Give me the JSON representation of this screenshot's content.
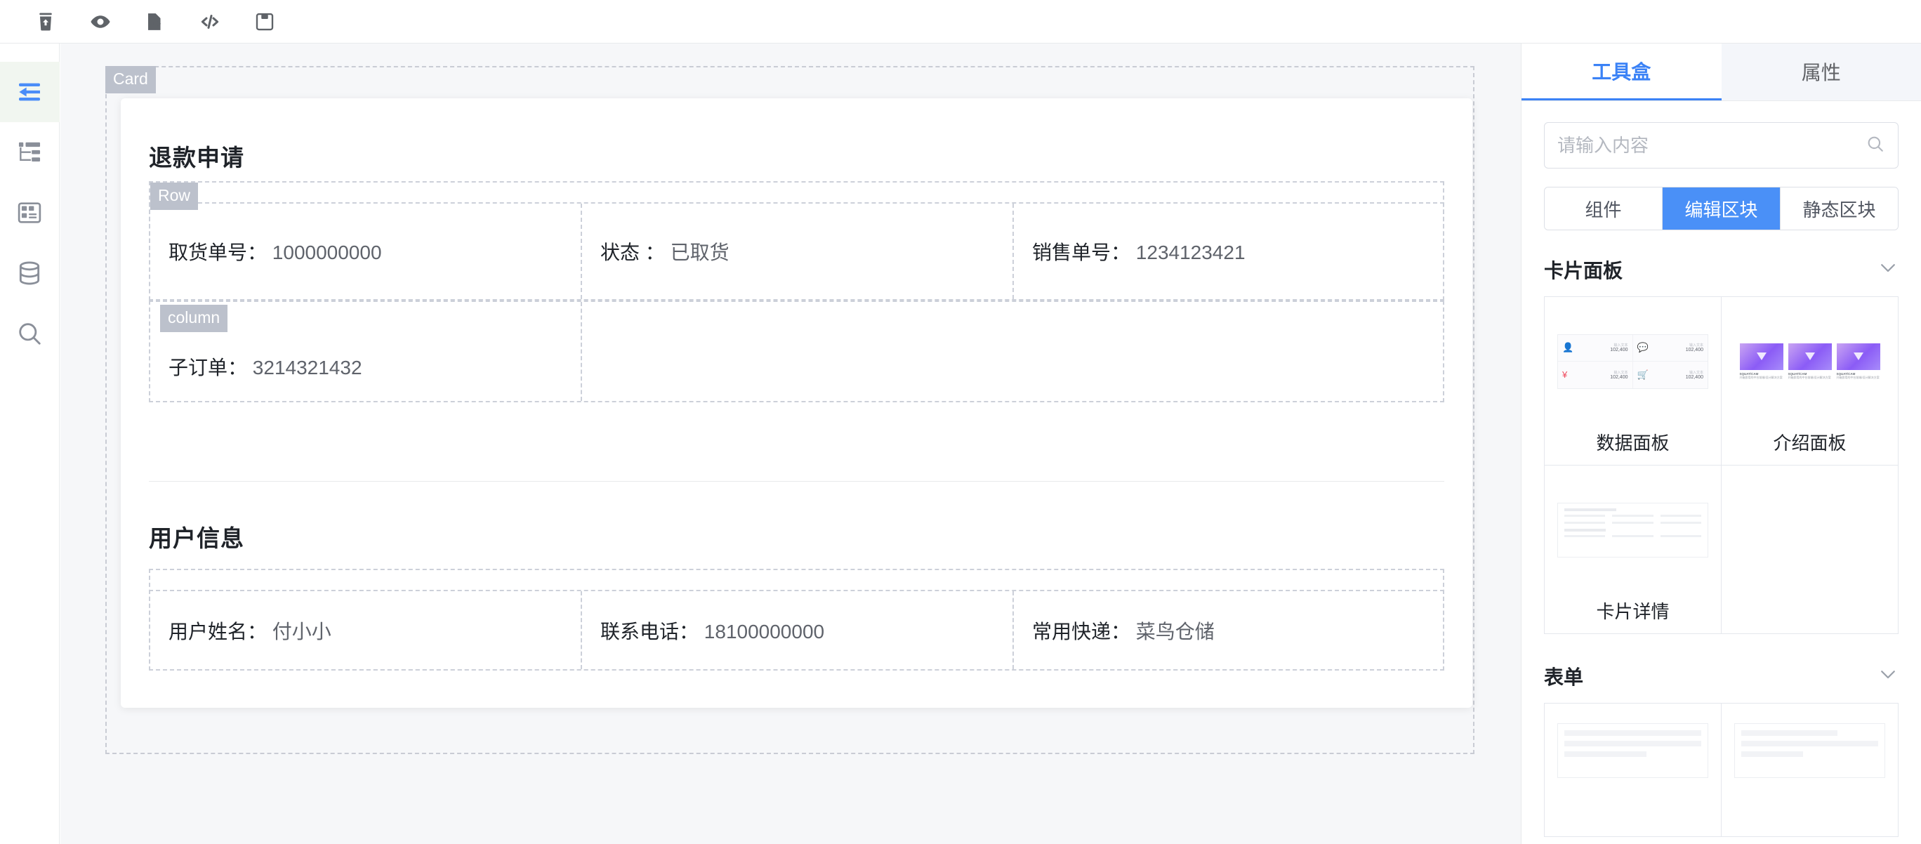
{
  "toolbar": {
    "items": [
      {
        "icon": "trash-upload-icon",
        "label": "清空"
      },
      {
        "icon": "eye-preview-icon",
        "label": "预览"
      },
      {
        "icon": "file-export-icon",
        "label": "导出"
      },
      {
        "icon": "code-icon",
        "label": "源码"
      },
      {
        "icon": "save-icon",
        "label": "保存"
      }
    ]
  },
  "left_rail": {
    "items": [
      {
        "icon": "collapse-left-icon",
        "label": "折叠",
        "active": true
      },
      {
        "icon": "tree-outline-icon",
        "label": "大纲树",
        "active": false
      },
      {
        "icon": "layout-grid-icon",
        "label": "布局",
        "active": false
      },
      {
        "icon": "database-icon",
        "label": "数据源",
        "active": false
      },
      {
        "icon": "search-icon",
        "label": "搜索",
        "active": false
      }
    ]
  },
  "canvas": {
    "tags": {
      "card": "Card",
      "row": "Row",
      "column": "column"
    },
    "sections": [
      {
        "title": "退款申请",
        "rows": [
          {
            "tag": "Row",
            "cells": [
              {
                "label": "取货单号：",
                "value": "1000000000"
              },
              {
                "label": "状态 ：",
                "value": "已取货"
              },
              {
                "label": "销售单号：",
                "value": "1234123421"
              }
            ]
          },
          {
            "tag": "column",
            "cells": [
              {
                "label": "子订单：",
                "value": "3214321432"
              },
              {
                "label": "",
                "value": ""
              }
            ]
          }
        ]
      },
      {
        "title": "用户信息",
        "rows": [
          {
            "tag": "",
            "cells": [
              {
                "label": "用户姓名：",
                "value": "付小小"
              },
              {
                "label": "联系电话：",
                "value": "18100000000"
              },
              {
                "label": "常用快递：",
                "value": "菜鸟仓储"
              }
            ]
          }
        ]
      }
    ]
  },
  "right_panel": {
    "tabs": [
      {
        "label": "工具盒",
        "active": true
      },
      {
        "label": "属性",
        "active": false
      }
    ],
    "search": {
      "placeholder": "请输入内容",
      "value": "",
      "icon": "search-icon"
    },
    "segments": [
      {
        "label": "组件",
        "active": false
      },
      {
        "label": "编辑区块",
        "active": true
      },
      {
        "label": "静态区块",
        "active": false
      }
    ],
    "groups": [
      {
        "title": "卡片面板",
        "expanded": true,
        "chevron": "chevron-down-icon",
        "items": [
          {
            "caption": "数据面板",
            "thumb": "data-panel-thumb"
          },
          {
            "caption": "介绍面板",
            "thumb": "intro-panel-thumb"
          },
          {
            "caption": "卡片详情",
            "thumb": "card-detail-thumb"
          },
          {
            "caption": "",
            "thumb": ""
          }
        ]
      },
      {
        "title": "表单",
        "expanded": true,
        "chevron": "chevron-down-icon",
        "items": [
          {
            "caption": "",
            "thumb": "form-thumb-a"
          },
          {
            "caption": "",
            "thumb": "form-thumb-b"
          }
        ]
      }
    ],
    "thumb_text": {
      "data_panel_label": "输入文本",
      "data_panel_value": "102,400",
      "intro_title": "SQUAT/CAM",
      "intro_body": "开箱即用的中台前端/设计解决方案"
    },
    "colors": {
      "accent": "#3b82f6",
      "seg_active": "#4a90f7",
      "tag_bg": "#bcc1cc",
      "rail_active_bg": "#f1f6f0"
    }
  }
}
